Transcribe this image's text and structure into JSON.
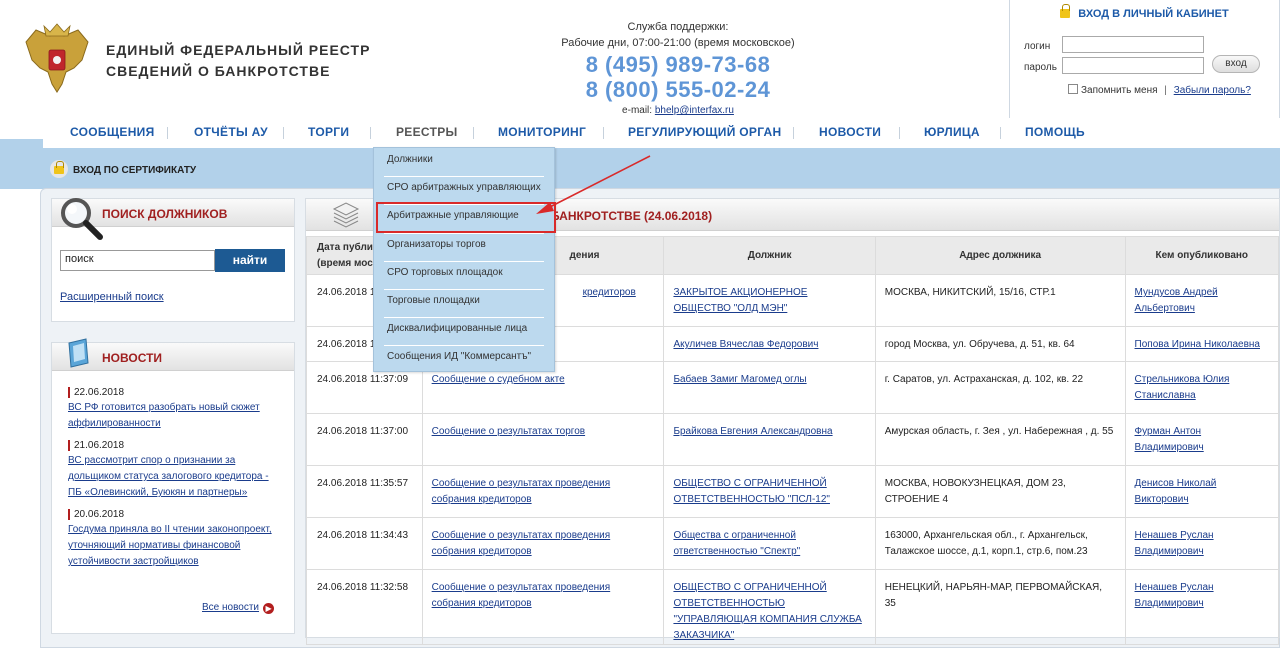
{
  "header": {
    "title_line1": "ЕДИНЫЙ  ФЕДЕРАЛЬНЫЙ  РЕЕСТР",
    "title_line2": "СВЕДЕНИЙ О БАНКРОТСТВЕ"
  },
  "support": {
    "title": "Служба поддержки:",
    "hours": "Рабочие дни, 07:00-21:00 (время московское)",
    "phone1": "8 (495) 989-73-68",
    "phone2": "8 (800) 555-02-24",
    "email_label": "e-mail:",
    "email": "bhelp@interfax.ru"
  },
  "login": {
    "title": "ВХОД В ЛИЧНЫЙ КАБИНЕТ",
    "login_label": "логин",
    "password_label": "пароль",
    "submit": "вход",
    "remember": "Запомнить меня",
    "separator": "|",
    "forgot": "Забыли пароль?"
  },
  "nav": {
    "items": [
      "СООБЩЕНИЯ",
      "ОТЧЁТЫ АУ",
      "ТОРГИ",
      "РЕЕСТРЫ",
      "МОНИТОРИНГ",
      "РЕГУЛИРУЮЩИЙ ОРГАН",
      "НОВОСТИ",
      "ЮРЛИЦА",
      "ПОМОЩЬ"
    ],
    "active": "РЕЕСТРЫ"
  },
  "cert_login": "ВХОД ПО СЕРТИФИКАТУ",
  "search": {
    "title": "ПОИСК ДОЛЖНИКОВ",
    "value": "поиск",
    "button": "найти",
    "advanced": "Расширенный поиск"
  },
  "news": {
    "title": "НОВОСТИ",
    "items": [
      {
        "date": "22.06.2018",
        "text": "ВС РФ готовится разобрать новый сюжет аффилированности"
      },
      {
        "date": "21.06.2018",
        "text": "ВС рассмотрит спор о признании за дольщиком статуса залогового кредитора - ПБ «Олевинский, Буюкян и партнеры»"
      },
      {
        "date": "20.06.2018",
        "text": "Госдума приняла во II чтении законопроект, уточняющий нормативы финансовой устойчивости застройщиков"
      }
    ],
    "all_link": "Все новости"
  },
  "messages": {
    "title_visible": "БАНКРОТСТВЕ (24.06.2018)",
    "columns": [
      "Дата публи",
      "(время моск",
      "дения",
      "Должник",
      "Адрес должника",
      "Кем опубликовано"
    ],
    "rows": [
      {
        "date": "24.06.2018 1",
        "type": "кредиторов",
        "debtor": "ЗАКРЫТОЕ АКЦИОНЕРНОЕ ОБЩЕСТВО \"ОЛД МЭН\"",
        "address": "МОСКВА, НИКИТСКИЙ, 15/16, СТР.1",
        "publisher": "Мундусов Андрей Альбертович"
      },
      {
        "date": "24.06.2018 1",
        "type": "",
        "debtor": "Акуличев Вячеслав Федорович",
        "address": "город Москва, ул. Обручева, д. 51, кв. 64",
        "publisher": "Попова Ирина Николаевна"
      },
      {
        "date": "24.06.2018 11:37:09",
        "type": "Сообщение о судебном акте",
        "debtor": "Бабаев Замиг Магомед оглы",
        "address": "г. Саратов, ул. Астраханская, д. 102, кв. 22",
        "publisher": "Стрельникова Юлия Станиславна"
      },
      {
        "date": "24.06.2018 11:37:00",
        "type": "Сообщение о результатах торгов",
        "debtor": "Брайкова Евгения Александровна",
        "address": "Амурская область, г. Зея , ул. Набережная , д. 55",
        "publisher": "Фурман Антон Владимирович"
      },
      {
        "date": "24.06.2018 11:35:57",
        "type": "Сообщение о результатах проведения собрания кредиторов",
        "debtor": "ОБЩЕСТВО С ОГРАНИЧЕННОЙ ОТВЕТСТВЕННОСТЬЮ \"ПСЛ-12\"",
        "address": "МОСКВА, НОВОКУЗНЕЦКАЯ, ДОМ 23, СТРОЕНИЕ 4",
        "publisher": "Денисов Николай Викторович"
      },
      {
        "date": "24.06.2018 11:34:43",
        "type": "Сообщение о результатах проведения собрания кредиторов",
        "debtor": "Общества с ограниченной ответственностью \"Спектр\"",
        "address": "163000, Архангельская обл., г. Архангельск, Талажское шоссе, д.1, корп.1, стр.6, пом.23",
        "publisher": "Ненашев Руслан Владимирович"
      },
      {
        "date": "24.06.2018 11:32:58",
        "type": "Сообщение о результатах проведения собрания кредиторов",
        "debtor": "ОБЩЕСТВО С ОГРАНИЧЕННОЙ ОТВЕТСТВЕННОСТЬЮ \"УПРАВЛЯЮЩАЯ КОМПАНИЯ СЛУЖБА ЗАКАЗЧИКА\"",
        "address": "НЕНЕЦКИЙ, НАРЬЯН-МАР, ПЕРВОМАЙСКАЯ, 35",
        "publisher": "Ненашев Руслан Владимирович"
      }
    ]
  },
  "dropdown": {
    "items": [
      "Должники",
      "СРО арбитражных управляющих",
      "Арбитражные управляющие",
      "Организаторы торгов",
      "СРО торговых площадок",
      "Торговые площадки",
      "Дисквалифицированные лица",
      "Сообщения ИД \"Коммерсантъ\""
    ],
    "highlighted": "Арбитражные управляющие"
  },
  "colors": {
    "nav_link": "#1d5aa8",
    "phone": "#5e95d6",
    "accent_red": "#a02020",
    "dropdown_bg": "#bcd9ee",
    "annotation": "#d92a2a"
  }
}
